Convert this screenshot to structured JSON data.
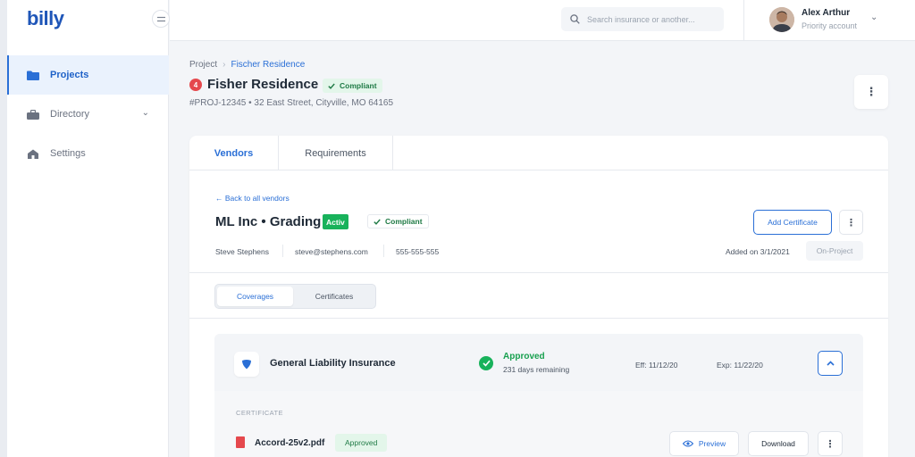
{
  "app": {
    "logo": "billy"
  },
  "sidebar": {
    "items": [
      {
        "label": "Projects",
        "active": true
      },
      {
        "label": "Directory",
        "active": false
      },
      {
        "label": "Settings",
        "active": false
      }
    ]
  },
  "header": {
    "search_placeholder": "Search insurance or another...",
    "user_name": "Alex Arthur",
    "user_role": "Priority account"
  },
  "page": {
    "breadcrumb": [
      "Project",
      "Fischer Residence"
    ],
    "alert_count": "4",
    "title": "Fisher Residence",
    "status": "Compliant",
    "meta": "#PROJ-12345 • 32 East Street, Cityville, MO 64165"
  },
  "tabs": [
    {
      "label": "Vendors",
      "active": true
    },
    {
      "label": "Requirements",
      "active": false
    }
  ],
  "vendor": {
    "back_label": "Back to all vendors",
    "name": "ML Inc • Grading",
    "state_badge": "Activ",
    "status": "Compliant",
    "contact_name": "Steve Stephens",
    "email": "steve@stephens.com",
    "phone": "555-555-555",
    "add_certificate_label": "Add Certificate",
    "added_on": "Added on 3/1/2021",
    "on_project_label": "On-Project"
  },
  "subtabs": [
    {
      "label": "Coverages",
      "active": true
    },
    {
      "label": "Certificates",
      "active": false
    }
  ],
  "coverage": {
    "title": "General Liability Insurance",
    "status": "Approved",
    "remaining": "231 days remaining",
    "eff": "Eff: 11/12/20",
    "exp": "Exp: 11/22/20",
    "section_label": "CERTIFICATE",
    "file": {
      "name": "Accord-25v2.pdf",
      "status": "Approved",
      "preview_label": "Preview",
      "download_label": "Download"
    }
  },
  "colors": {
    "accent": "#2a6fd6",
    "success": "#18b25b",
    "danger": "#e5484d"
  }
}
